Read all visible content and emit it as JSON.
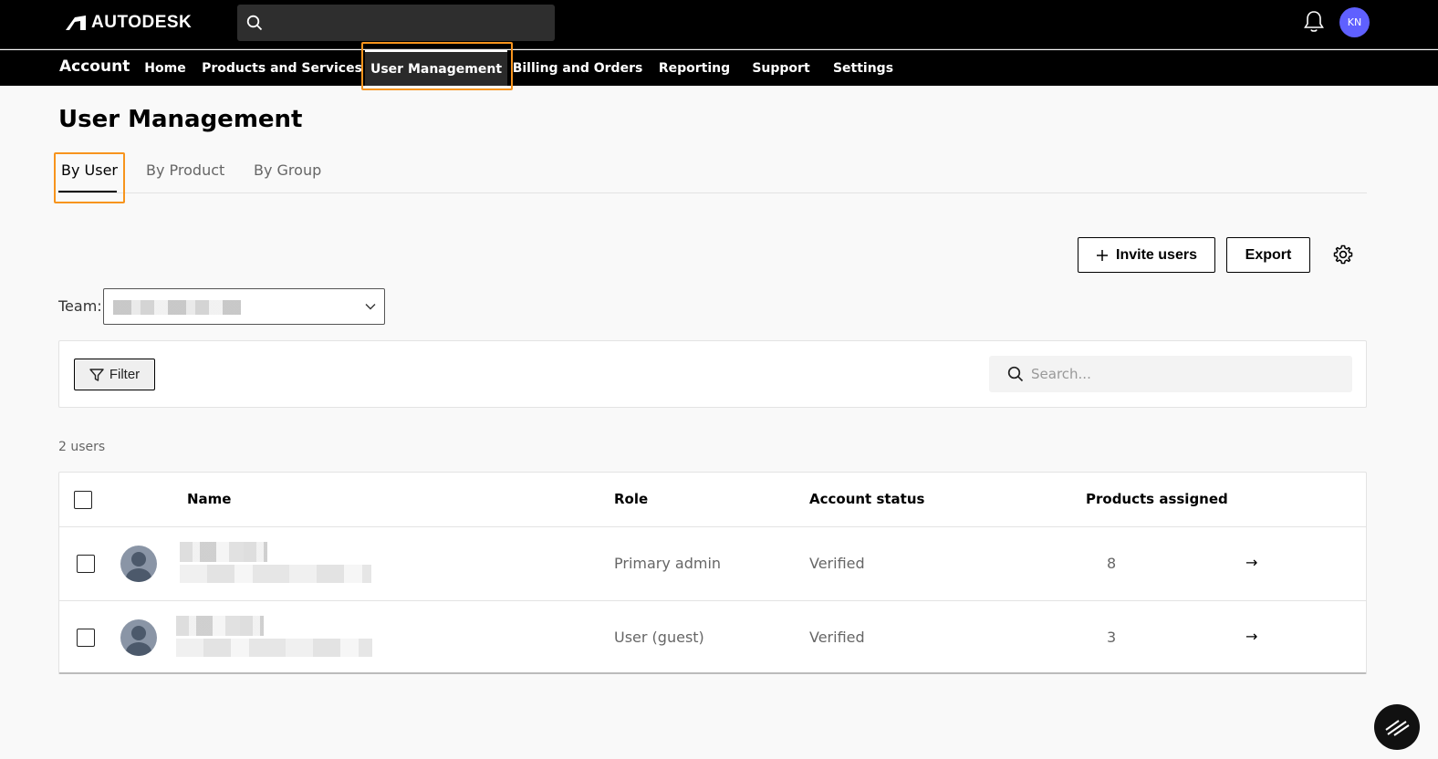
{
  "header": {
    "brand": "AUTODESK",
    "user_initials": "KN"
  },
  "nav": {
    "section": "Account",
    "items": [
      "Home",
      "Products and Services",
      "User Management",
      "Billing and Orders",
      "Reporting",
      "Support",
      "Settings"
    ],
    "active": "User Management"
  },
  "page": {
    "title": "User Management",
    "tabs": [
      "By User",
      "By Product",
      "By Group"
    ],
    "active_tab": "By User"
  },
  "actions": {
    "invite_label": "Invite users",
    "export_label": "Export"
  },
  "team": {
    "label": "Team:"
  },
  "filter": {
    "button_label": "Filter",
    "search_placeholder": "Search..."
  },
  "table": {
    "count_text": "2 users",
    "columns": [
      "Name",
      "Role",
      "Account status",
      "Products assigned"
    ],
    "rows": [
      {
        "role": "Primary admin",
        "status": "Verified",
        "products": "8"
      },
      {
        "role": "User (guest)",
        "status": "Verified",
        "products": "3"
      }
    ]
  },
  "colors": {
    "highlight": "#f7941d",
    "avatar_bg": "#5f60ff"
  }
}
